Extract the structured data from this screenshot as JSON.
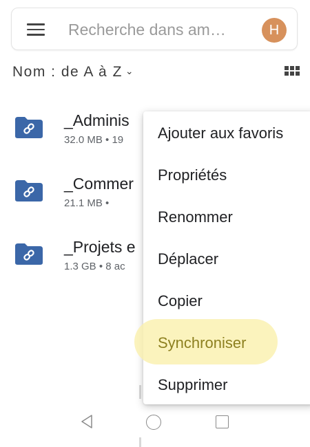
{
  "search": {
    "placeholder": "Recherche dans am…",
    "avatar_letter": "H",
    "avatar_color": "#d7915c"
  },
  "sort": {
    "label": "Nom : de A à Z",
    "chevron": "⌄"
  },
  "files": [
    {
      "name": "_Adminis",
      "meta": "32.0 MB • 19",
      "icon": "shared-folder-icon"
    },
    {
      "name": "_Commer",
      "meta": "21.1 MB •",
      "icon": "shared-folder-icon"
    },
    {
      "name": "_Projets e",
      "meta": "1.3 GB • 8 ac",
      "icon": "shared-folder-icon"
    }
  ],
  "context_menu": {
    "items": [
      {
        "label": "Ajouter aux favoris"
      },
      {
        "label": "Propriétés"
      },
      {
        "label": "Renommer"
      },
      {
        "label": "Déplacer"
      },
      {
        "label": "Copier"
      },
      {
        "label": "Synchroniser",
        "highlighted": true
      },
      {
        "label": "Supprimer"
      }
    ]
  },
  "colors": {
    "folder": "#3b67a8",
    "highlight_text": "#8d8020",
    "highlight_bg": "#faf0aa"
  }
}
